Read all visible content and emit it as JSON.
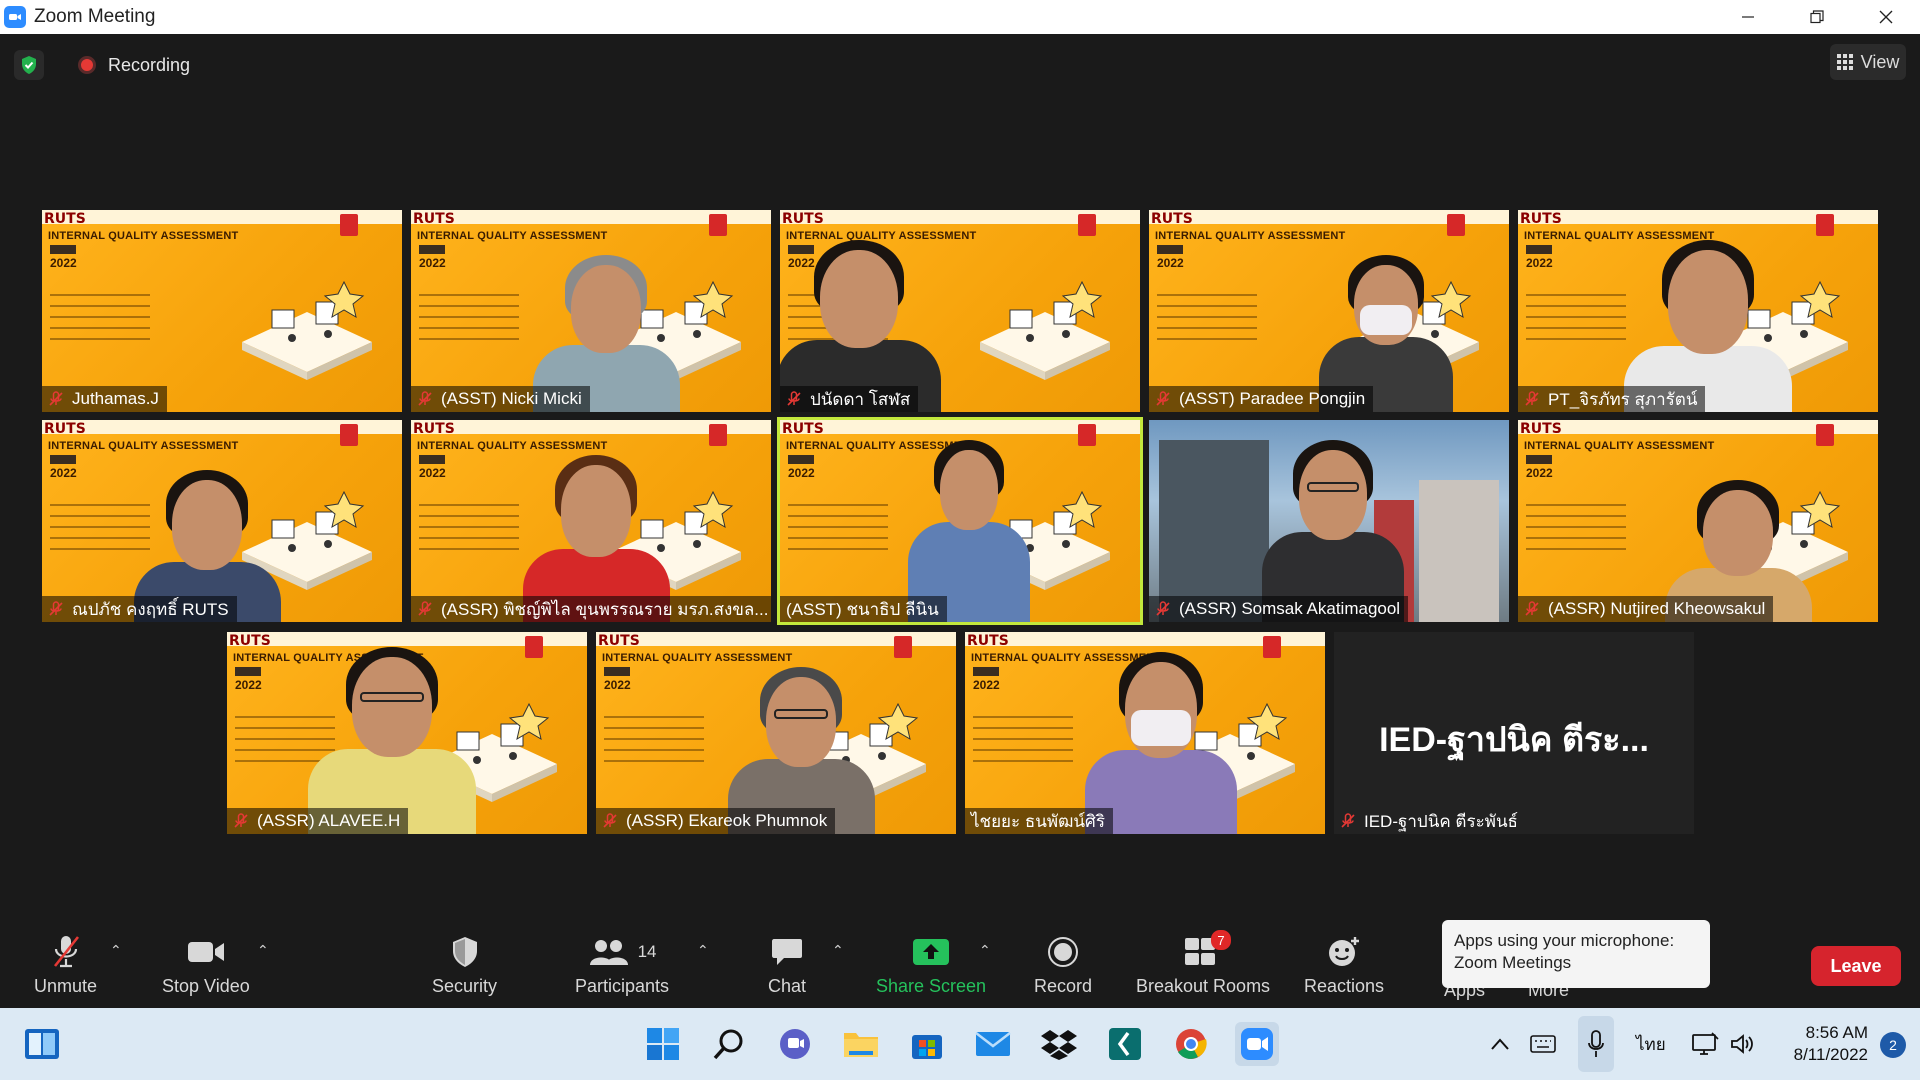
{
  "window": {
    "title": "Zoom Meeting"
  },
  "meeting": {
    "recording_label": "Recording",
    "view_label": "View",
    "slide": {
      "logo": "RUTS",
      "heading": "INTERNAL QUALITY ASSESSMENT",
      "month": "AUG",
      "year": "2022"
    },
    "tiles": [
      {
        "name": "Juthamas.J",
        "muted": true
      },
      {
        "name": "(ASST) Nicki Micki",
        "muted": true
      },
      {
        "name": "ปนัดดา โสฬส",
        "muted": true
      },
      {
        "name": "(ASST) Paradee Pongjin",
        "muted": true
      },
      {
        "name": "PT_จิรภัทร สุภารัตน์",
        "muted": true
      },
      {
        "name": "ณปภัช คงฤทธิ์ RUTS",
        "muted": true
      },
      {
        "name": "(ASSR) พิชญ์พิไล ขุนพรรณราย มรภ.สงขล...",
        "muted": true
      },
      {
        "name": "(ASST) ชนาธิป ลีนิน",
        "muted": false
      },
      {
        "name": "(ASSR) Somsak Akatimagool",
        "muted": true
      },
      {
        "name": "(ASSR) Nutjired Kheowsakul",
        "muted": true
      },
      {
        "name": "(ASSR) ALAVEE.H",
        "muted": true
      },
      {
        "name": "(ASSR) Ekareok Phumnok",
        "muted": true
      },
      {
        "name": "ไชยยะ ธนพัฒน์ศิริ",
        "muted": false
      },
      {
        "name": "IED-ฐาปนิค ตีระพันธ์",
        "muted": true,
        "display_text": "IED-ฐาปนิค ตีระ..."
      }
    ]
  },
  "toolbar": {
    "unmute": "Unmute",
    "stop_video": "Stop Video",
    "security": "Security",
    "participants": "Participants",
    "participants_count": "14",
    "chat": "Chat",
    "share_screen": "Share Screen",
    "record": "Record",
    "breakout_rooms": "Breakout Rooms",
    "breakout_badge": "7",
    "reactions": "Reactions",
    "apps": "Apps",
    "more": "More",
    "tooltip": "Apps using your microphone: Zoom Meetings",
    "leave": "Leave"
  },
  "taskbar": {
    "language": "ไทย",
    "time": "8:56 AM",
    "date": "8/11/2022",
    "notifications": "2"
  },
  "colors": {
    "accent_green": "#25c15c",
    "leave_red": "#d6242d",
    "slide_orange": "#f7a80f",
    "active_border": "#c3e83c"
  }
}
